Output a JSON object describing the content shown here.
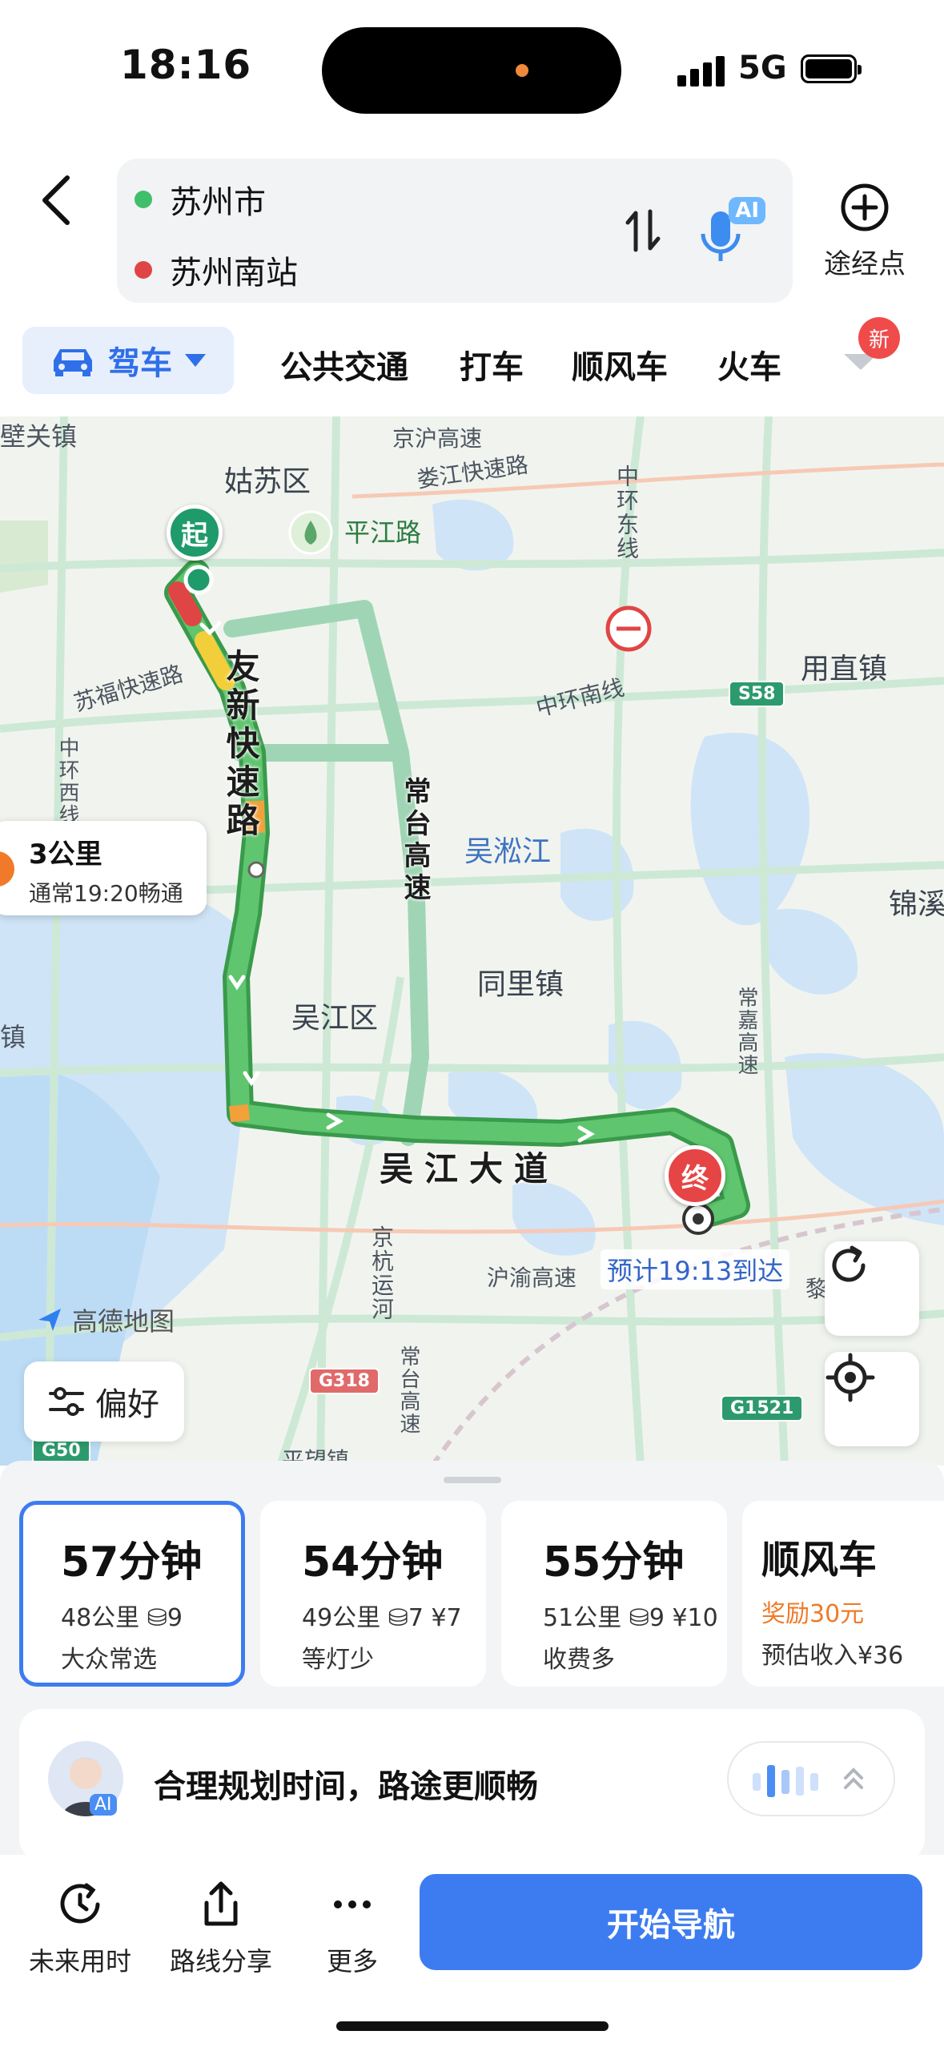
{
  "status": {
    "time": "18:16",
    "network": "5G"
  },
  "header": {
    "origin": "苏州市",
    "destination": "苏州南站",
    "ai_tag": "AI",
    "waypoint_label": "途经点",
    "colors": {
      "origin_dot": "#3fbf6a",
      "destination_dot": "#e04545"
    }
  },
  "modes": {
    "active": "驾车",
    "tabs": [
      "公共交通",
      "打车",
      "顺风车",
      "火车"
    ],
    "new_badge": "新"
  },
  "map": {
    "labels": [
      "壁关镇",
      "姑苏区",
      "平江路",
      "京沪高速",
      "娄江快速路",
      "中环东线",
      "苏福快速路",
      "中环西线",
      "中环南线",
      "用直镇",
      "吴淞江",
      "同里镇",
      "吴江区",
      "锦溪",
      "常嘉高速",
      "沪渝高速",
      "京杭运河",
      "常台高速",
      "平望镇",
      "镇",
      "黎里"
    ],
    "road_names": {
      "youxin": "友新快速路",
      "changtai": "常台高速",
      "wujiang": "吴江大道"
    },
    "shields": [
      "S58",
      "G318",
      "G1521",
      "G50"
    ],
    "start_label": "起",
    "end_label": "终",
    "eta": "预计19:13到达",
    "info_card": {
      "distance": "3公里",
      "subtitle": "通常19:20畅通"
    },
    "logo": "高德地图",
    "preference": "偏好",
    "route_color": "#4bb85a",
    "alt_route_color": "#9fd5b4"
  },
  "routes": [
    {
      "duration": "57分钟",
      "meta": "48公里 ⛁9",
      "tag": "大众常选",
      "selected": true
    },
    {
      "duration": "54分钟",
      "meta": "49公里 ⛁7 ¥7",
      "tag": "等灯少",
      "selected": false
    },
    {
      "duration": "55分钟",
      "meta": "51公里 ⛁9 ¥10",
      "tag": "收费多",
      "selected": false
    }
  ],
  "carpool": {
    "title": "顺风车",
    "reward": "奖励30元",
    "income": "预估收入¥36"
  },
  "ai_bar": {
    "avatar_tag": "AI",
    "text": "合理规划时间，路途更顺畅"
  },
  "bottom": {
    "future": "未来用时",
    "share": "路线分享",
    "more": "更多",
    "start": "开始导航"
  }
}
